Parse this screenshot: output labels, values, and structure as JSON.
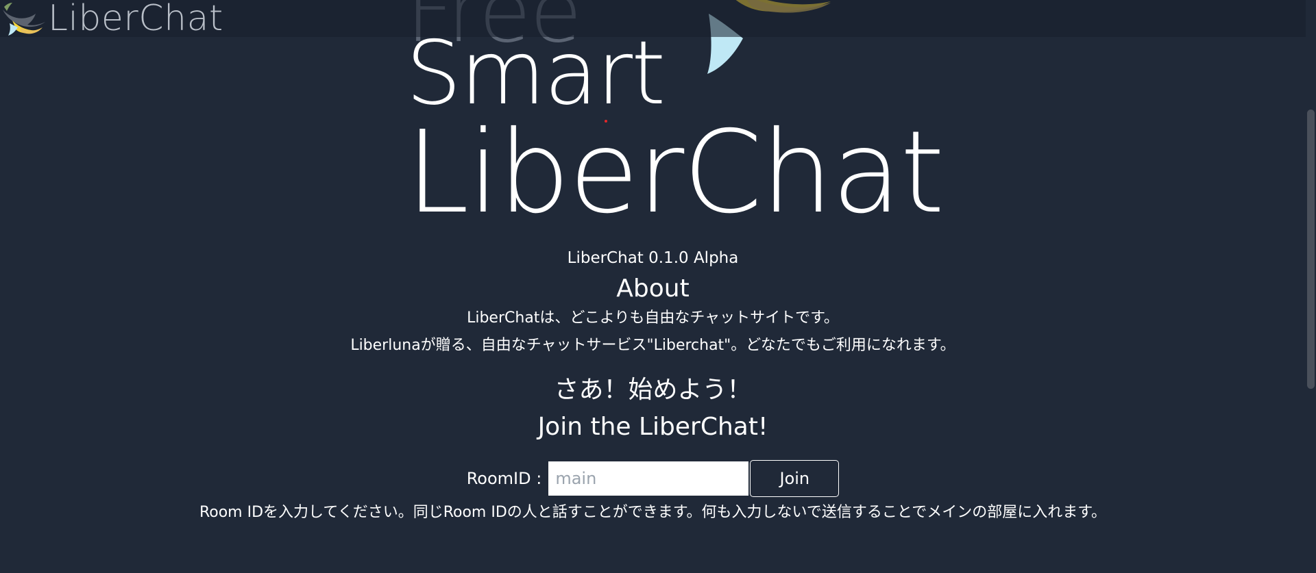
{
  "header": {
    "brand_name": "LiberChat",
    "brand_icon": "liberchat-bird-logo"
  },
  "hero": {
    "line1": "Free",
    "line2": "Smart",
    "line3": "LiberChat",
    "illustration": "bird-illustration"
  },
  "main": {
    "version": "LiberChat 0.1.0 Alpha",
    "about_title": "About",
    "about_line1": "LiberChatは、どこよりも自由なチャットサイトです。",
    "about_line2": "Liberlunaが贈る、自由なチャットサービス\"Liberchat\"。どなたでもご利用になれます。",
    "start_title_ja": "さあ！始めよう！",
    "start_title_en": "Join the LiberChat!",
    "room_label": "RoomID :",
    "room_input_value": "",
    "room_input_placeholder": "main",
    "join_button": "Join",
    "room_help": "Room IDを入力してください。同じRoom IDの人と話すことができます。何も入力しないで送信することでメインの部屋に入れます。"
  },
  "colors": {
    "background": "#202938",
    "text": "#ffffff",
    "header_text": "#b9bfc8",
    "accent_yellow": "#f3d33a"
  }
}
